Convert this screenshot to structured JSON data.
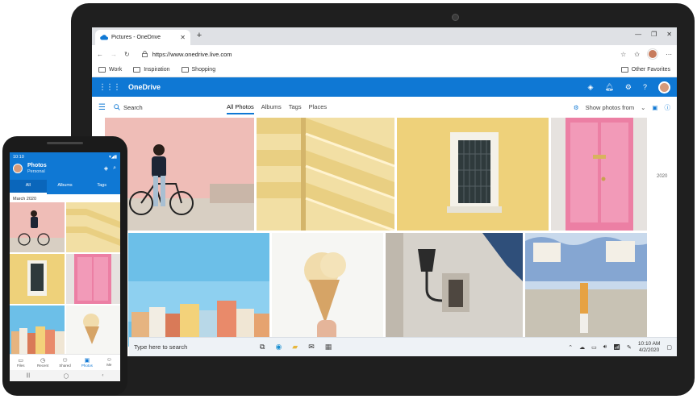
{
  "browser": {
    "tab_title": "Pictures - OneDrive",
    "url": "https://www.onedrive.live.com",
    "favorites": [
      "Work",
      "Inspiration",
      "Shopping"
    ],
    "other_favorites": "Other Favorites"
  },
  "onedrive": {
    "app_name": "OneDrive",
    "search_label": "Search",
    "views": [
      "All Photos",
      "Albums",
      "Tags",
      "Places"
    ],
    "show_photos_label": "Show photos from",
    "year_label": "2020"
  },
  "taskbar": {
    "search_placeholder": "Type here to search",
    "time": "10:10 AM",
    "date": "4/2/2020"
  },
  "phone": {
    "status_time": "10:10",
    "title": "Photos",
    "subtitle": "Personal",
    "tabs": [
      "All",
      "Albums",
      "Tags"
    ],
    "date_header": "March 2020",
    "nav": [
      "Files",
      "Recent",
      "Shared",
      "Photos",
      "Me"
    ]
  },
  "colors": {
    "accent": "#0f78d4"
  }
}
